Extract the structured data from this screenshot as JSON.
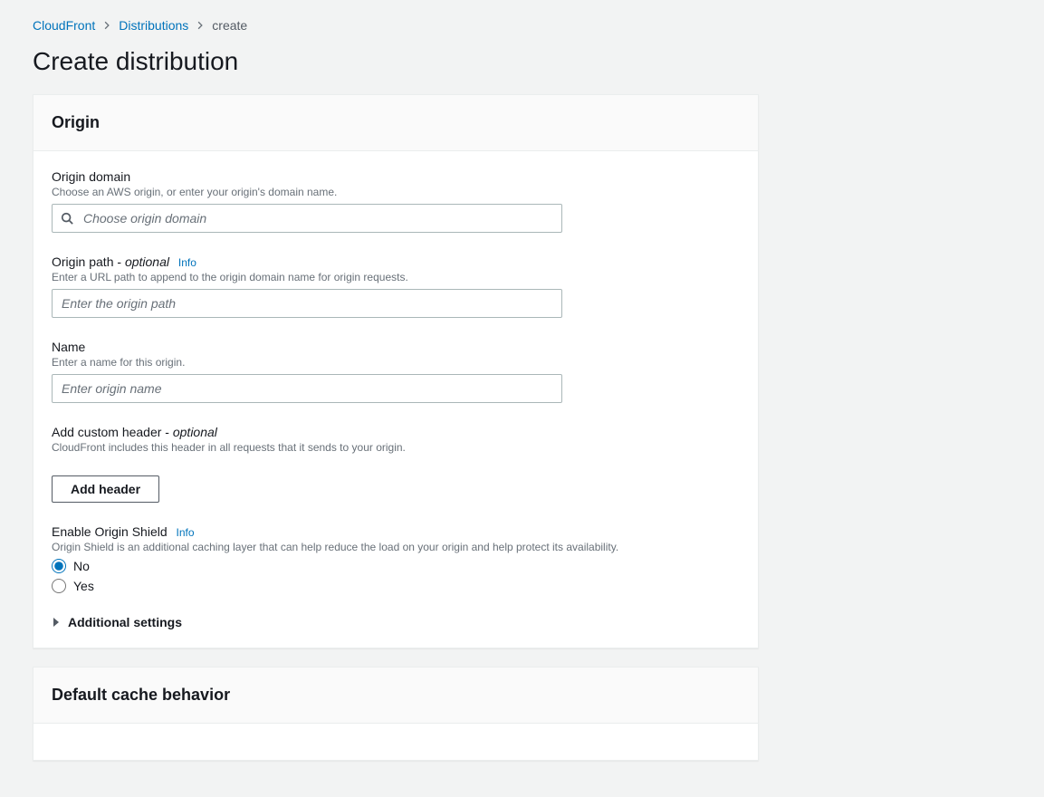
{
  "breadcrumb": {
    "items": [
      {
        "label": "CloudFront"
      },
      {
        "label": "Distributions"
      }
    ],
    "current": "create"
  },
  "page_title": "Create distribution",
  "info_label": "Info",
  "origin_panel": {
    "title": "Origin",
    "domain": {
      "label": "Origin domain",
      "desc": "Choose an AWS origin, or enter your origin's domain name.",
      "placeholder": "Choose origin domain"
    },
    "path": {
      "label_prefix": "Origin path - ",
      "label_optional": "optional",
      "desc": "Enter a URL path to append to the origin domain name for origin requests.",
      "placeholder": "Enter the origin path"
    },
    "name": {
      "label": "Name",
      "desc": "Enter a name for this origin.",
      "placeholder": "Enter origin name"
    },
    "custom_header": {
      "label_prefix": "Add custom header - ",
      "label_optional": "optional",
      "desc": "CloudFront includes this header in all requests that it sends to your origin.",
      "button": "Add header"
    },
    "origin_shield": {
      "label": "Enable Origin Shield",
      "desc": "Origin Shield is an additional caching layer that can help reduce the load on your origin and help protect its availability.",
      "option_no": "No",
      "option_yes": "Yes",
      "selected": "no"
    },
    "additional_settings": "Additional settings"
  },
  "cache_panel": {
    "title": "Default cache behavior"
  }
}
